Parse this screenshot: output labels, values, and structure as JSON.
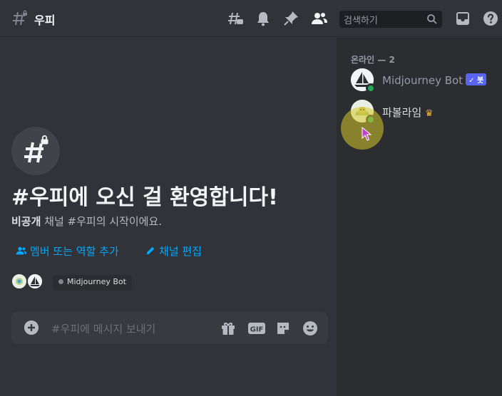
{
  "header": {
    "channel_name": "우피",
    "search_placeholder": "검색하기"
  },
  "welcome": {
    "title": "#우피에 오신 걸 환영합니다!",
    "subtitle_bold": "비공개",
    "subtitle_rest": " 채널 #우피의 시작이에요.",
    "add_members_label": "멤버 또는 역할 추가",
    "edit_channel_label": "채널 편집",
    "chip_label": "Midjourney Bot"
  },
  "composer": {
    "placeholder": "#우피에 메시지 보내기"
  },
  "members": {
    "heading": "온라인 — 2",
    "items": [
      {
        "name": "Midjourney Bot",
        "badge": "✓ 봇",
        "status": "online"
      },
      {
        "name": "파볼라임",
        "crown": "♛",
        "status": "online"
      }
    ]
  },
  "colors": {
    "accent": "#5865f2",
    "link": "#00a8fc",
    "online": "#23a55a",
    "crown": "#f0b232"
  }
}
